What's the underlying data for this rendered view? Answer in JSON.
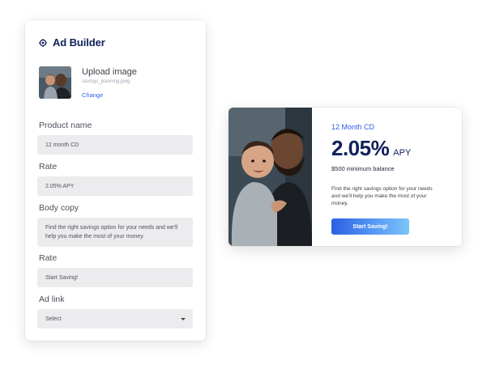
{
  "builder": {
    "title": "Ad Builder",
    "upload": {
      "title": "Upload image",
      "filename": "savings_planning.jpeg",
      "change_label": "Change"
    },
    "fields": {
      "product_name": {
        "label": "Product name",
        "value": "12 month CD"
      },
      "rate": {
        "label": "Rate",
        "value": "2.05% APY"
      },
      "body_copy": {
        "label": "Body copy",
        "value": "Find the right savings option for your needs and we'll help you make the most of your money."
      },
      "cta": {
        "label": "Rate",
        "value": "Start Saving!"
      },
      "ad_link": {
        "label": "Ad link",
        "value": "Select"
      }
    }
  },
  "ad_preview": {
    "eyebrow": "12 Month CD",
    "rate": "2.05%",
    "rate_suffix": "APY",
    "minimum": "$500 minimum balance",
    "copy": "Find the right savings option for your needs and we'll help you make the most of your money.",
    "cta_label": "Start Saving!"
  },
  "colors": {
    "brand_navy": "#10205a",
    "accent_blue": "#2f5ee8",
    "field_bg": "#ececee"
  },
  "icons": {
    "brand": "target-icon",
    "select": "chevron-down-icon"
  }
}
